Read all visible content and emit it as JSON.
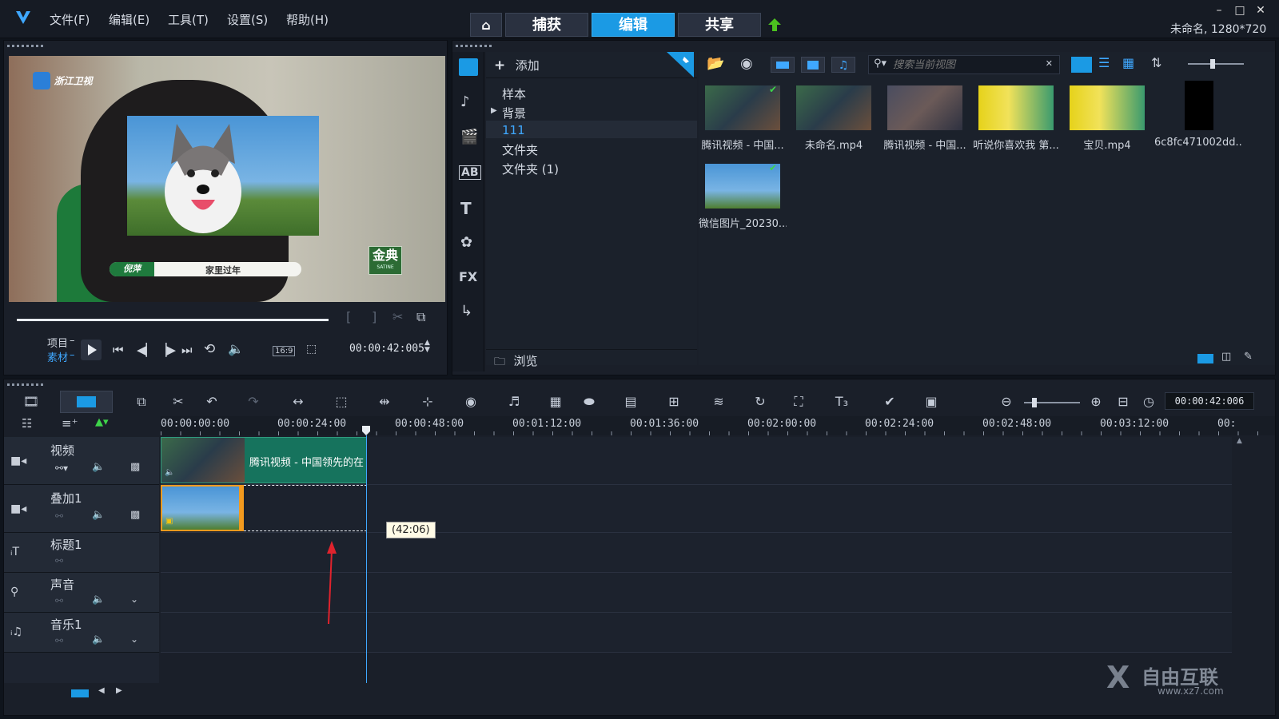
{
  "menu": [
    "文件(F)",
    "编辑(E)",
    "工具(T)",
    "设置(S)",
    "帮助(H)"
  ],
  "tabs": [
    "捕获",
    "编辑",
    "共享"
  ],
  "project_info": "未命名, 1280*720",
  "preview": {
    "station_logo": "浙江卫视",
    "caption_name": "倪萍",
    "caption_text": "家里过年",
    "brand": "金典",
    "brand_sub": "SATINE",
    "project_label": "项目",
    "clip_label": "素材",
    "aspect": "16:9",
    "timecode": "00:00:42:005"
  },
  "library": {
    "add_label": "添加",
    "tree": [
      "样本",
      "背景",
      "111",
      "文件夹",
      "文件夹 (1)"
    ],
    "browse_label": "浏览",
    "search_placeholder": "搜索当前视图",
    "thumbnails": [
      {
        "caption": "腾讯视频 - 中国..."
      },
      {
        "caption": "未命名.mp4"
      },
      {
        "caption": "腾讯视频 - 中国..."
      },
      {
        "caption": "听说你喜欢我 第..."
      },
      {
        "caption": "宝贝.mp4"
      },
      {
        "caption": "6c8fc471002dd..."
      },
      {
        "caption": "微信图片_20230..."
      }
    ]
  },
  "timeline": {
    "timecode": "00:00:42:006",
    "ruler": [
      "00:00:00:00",
      "00:00:24:00",
      "00:00:48:00",
      "00:01:12:00",
      "00:01:36:00",
      "00:02:00:00",
      "00:02:24:00",
      "00:02:48:00",
      "00:03:12:00",
      "00:"
    ],
    "tracks": [
      "视频",
      "叠加1",
      "标题1",
      "声音",
      "音乐1"
    ],
    "video_clip_label": "腾讯视频 - 中国领先的在",
    "tooltip": "(42:06)"
  },
  "watermark": {
    "text": "自由互联",
    "url": "www.xz7.com"
  },
  "colors": {
    "accent": "#1b9ae4",
    "clip_green": "#16735d",
    "overlay_orange": "#f29a1e"
  }
}
